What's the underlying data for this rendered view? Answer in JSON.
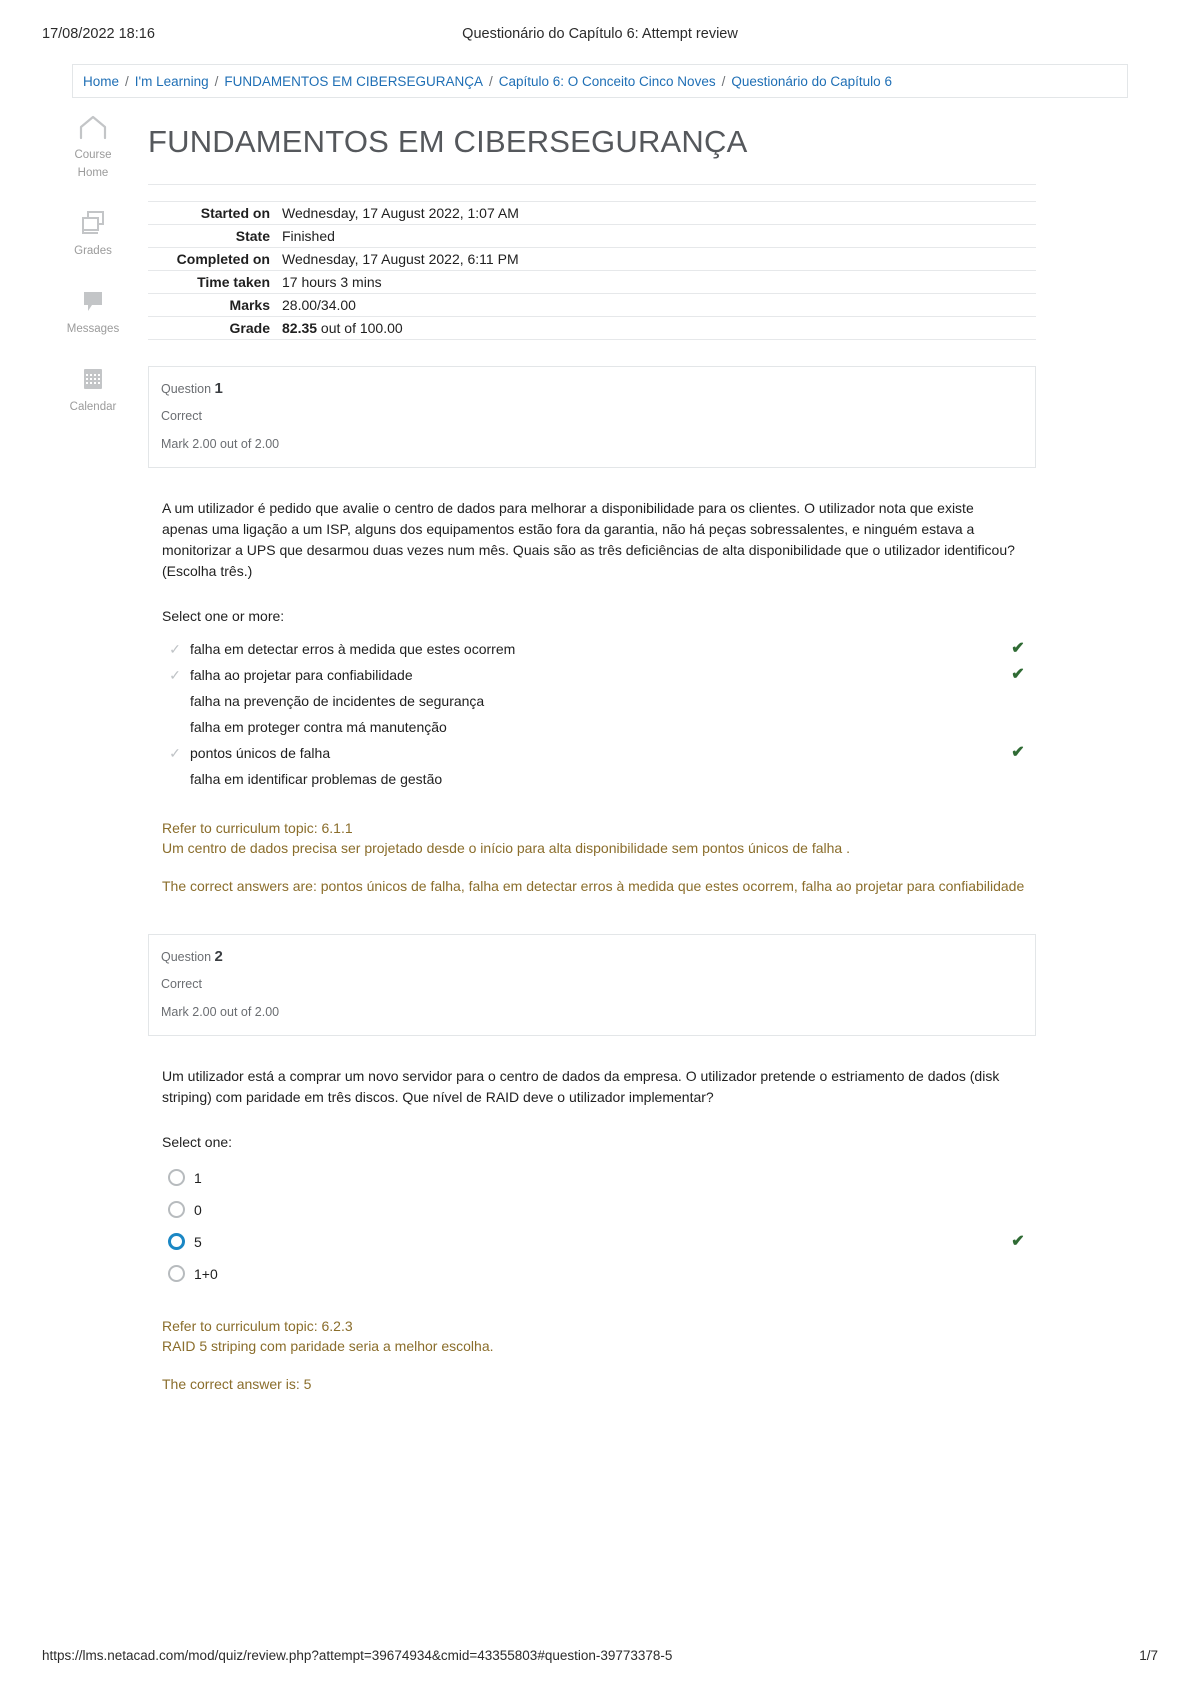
{
  "print_header": {
    "date": "17/08/2022 18:16",
    "title": "Questionário do Capítulo 6: Attempt review"
  },
  "breadcrumb": {
    "items": [
      "Home",
      "I'm Learning",
      "FUNDAMENTOS EM CIBERSEGURANÇA",
      "Capítulo 6: O Conceito Cinco Noves",
      "Questionário do Capítulo 6"
    ],
    "separator": "/"
  },
  "sidebar": {
    "items": [
      {
        "icon": "home-icon",
        "label_line1": "Course",
        "label_line2": "Home"
      },
      {
        "icon": "grades-icon",
        "label_line1": "Grades",
        "label_line2": ""
      },
      {
        "icon": "messages-icon",
        "label_line1": "Messages",
        "label_line2": ""
      },
      {
        "icon": "calendar-icon",
        "label_line1": "Calendar",
        "label_line2": ""
      }
    ]
  },
  "page_title": "FUNDAMENTOS EM CIBERSEGURANÇA",
  "summary": {
    "rows": [
      {
        "label": "Started on",
        "value": "Wednesday, 17 August 2022, 1:07 AM"
      },
      {
        "label": "State",
        "value": "Finished"
      },
      {
        "label": "Completed on",
        "value": "Wednesday, 17 August 2022, 6:11 PM"
      },
      {
        "label": "Time taken",
        "value": "17 hours 3 mins"
      },
      {
        "label": "Marks",
        "value": "28.00/34.00"
      }
    ],
    "grade": {
      "label": "Grade",
      "value_bold": "82.35",
      "value_rest": " out of 100.00"
    }
  },
  "questions": [
    {
      "number_label": "Question",
      "number": "1",
      "state": "Correct",
      "mark": "Mark 2.00 out of 2.00",
      "text": "A um utilizador é pedido que avalie o centro de dados para melhorar a disponibilidade para os clientes. O utilizador nota que existe apenas uma ligação a um ISP, alguns dos equipamentos estão fora da garantia, não há peças sobressalentes, e ninguém estava a monitorizar a UPS que desarmou duas vezes num mês. Quais são as três deficiências de alta disponibilidade que o utilizador identificou? (Escolha três.)",
      "prompt": "Select one or more:",
      "answer_type": "checkbox",
      "options": [
        {
          "text": "falha em detectar erros à medida que estes ocorrem",
          "selected": true,
          "correct": true
        },
        {
          "text": "falha ao projetar para confiabilidade",
          "selected": true,
          "correct": true
        },
        {
          "text": "falha na prevenção de incidentes de segurança",
          "selected": false,
          "correct": false
        },
        {
          "text": "falha em proteger contra má manutenção",
          "selected": false,
          "correct": false
        },
        {
          "text": "pontos únicos de falha",
          "selected": true,
          "correct": true
        },
        {
          "text": "falha em identificar problemas de gestão",
          "selected": false,
          "correct": false
        }
      ],
      "feedback_topic": "Refer to curriculum topic: 6.1.1",
      "feedback_text": "Um centro de dados precisa ser projetado desde o início para alta disponibilidade sem pontos únicos de falha .",
      "feedback_answer": "The correct answers are: pontos únicos de falha, falha em detectar erros à medida que estes ocorrem, falha ao projetar para confiabilidade"
    },
    {
      "number_label": "Question",
      "number": "2",
      "state": "Correct",
      "mark": "Mark 2.00 out of 2.00",
      "text": "Um utilizador está a comprar um novo servidor para o centro de dados da empresa. O utilizador pretende o estriamento de dados (disk striping) com paridade em três discos. Que nível de RAID deve o utilizador implementar?",
      "prompt": "Select one:",
      "answer_type": "radio",
      "options": [
        {
          "text": "1",
          "selected": false,
          "correct": false
        },
        {
          "text": "0",
          "selected": false,
          "correct": false
        },
        {
          "text": "5",
          "selected": true,
          "correct": true
        },
        {
          "text": "1+0",
          "selected": false,
          "correct": false
        }
      ],
      "feedback_topic": "Refer to curriculum topic: 6.2.3",
      "feedback_text": "RAID 5 striping com paridade seria a melhor escolha.",
      "feedback_answer": "The correct answer is: 5"
    }
  ],
  "icons": {
    "selected_check": "✓",
    "correct_check": "✔"
  },
  "print_footer": {
    "url": "https://lms.netacad.com/mod/quiz/review.php?attempt=39674934&cmid=43355803#question-39773378-5",
    "page": "1/7"
  },
  "colors": {
    "link": "#1f6fb5",
    "feedback": "#8a6d2b",
    "correct_green": "#2f6b34",
    "radio_selected": "#1b87c4"
  }
}
